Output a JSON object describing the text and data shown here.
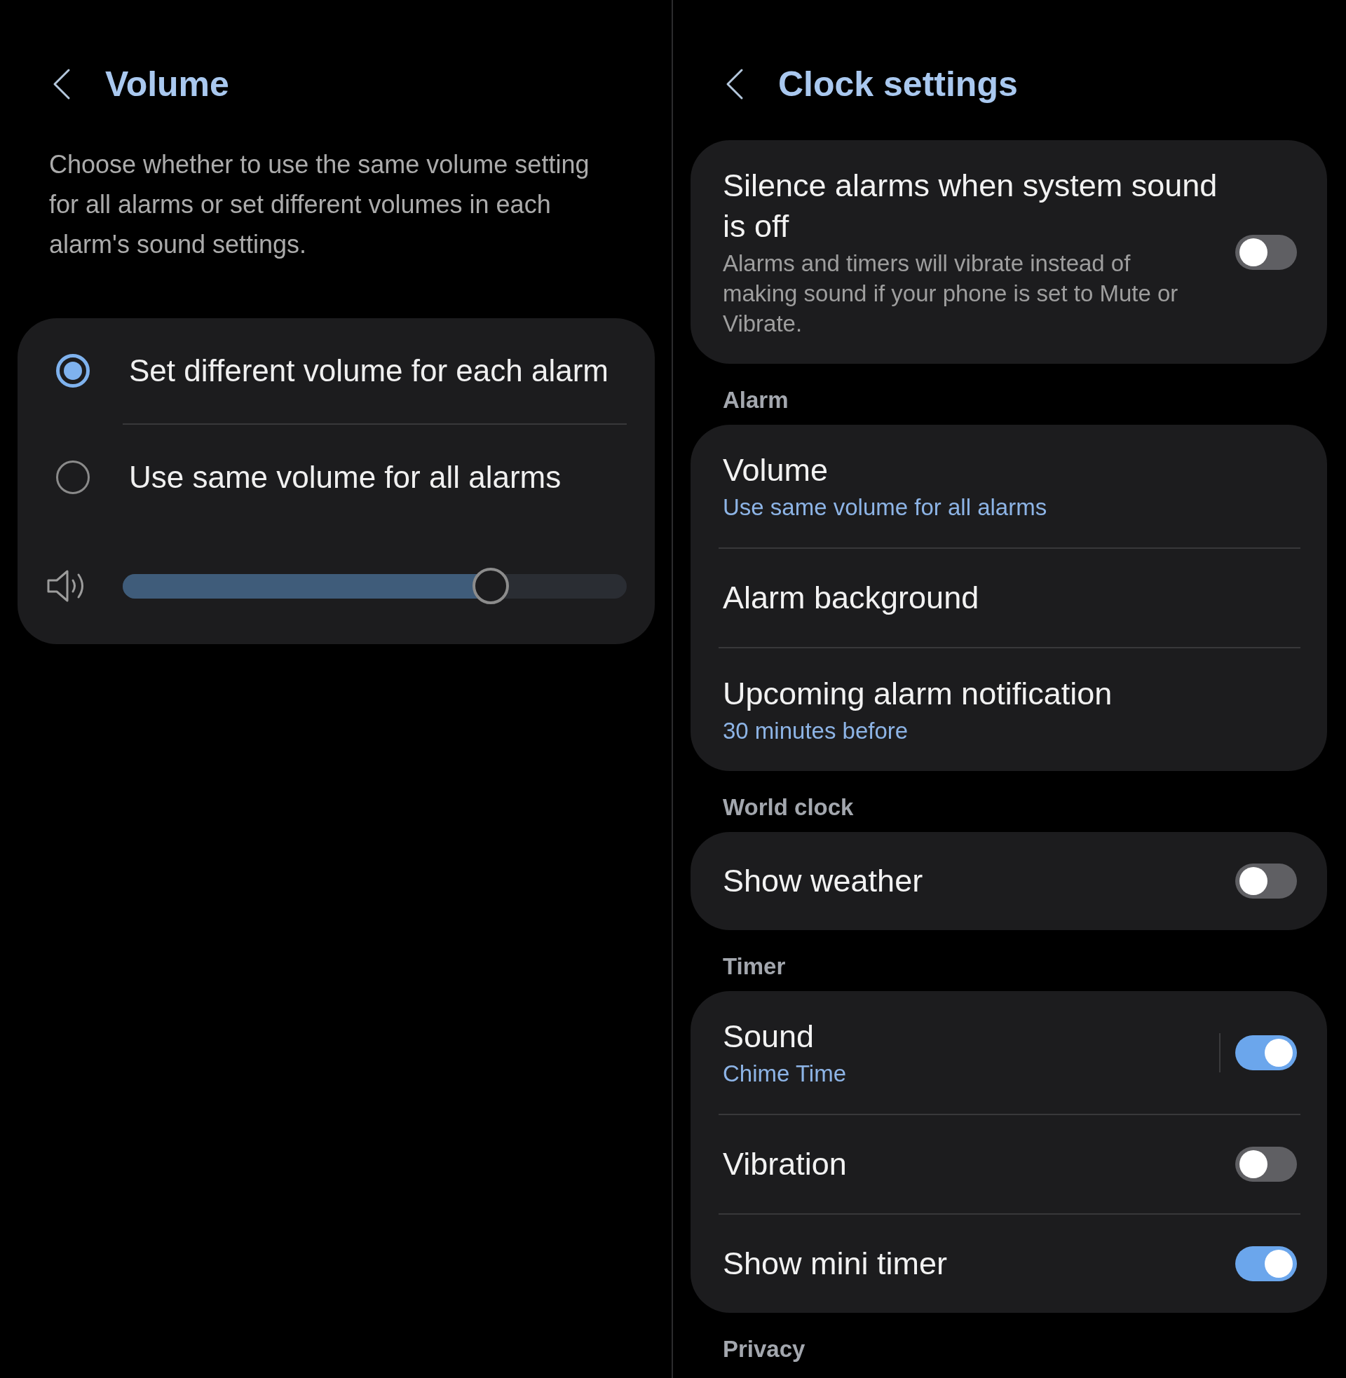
{
  "volume_screen": {
    "title": "Volume",
    "description": "Choose whether to use the same volume setting for all alarms or set different volumes in each alarm's sound settings.",
    "options": [
      {
        "label": "Set different volume for each alarm",
        "selected": true
      },
      {
        "label": "Use same volume for all alarms",
        "selected": false
      }
    ],
    "volume_slider": {
      "level": 0.73
    }
  },
  "clock_settings_screen": {
    "title": "Clock settings",
    "sections": [
      {
        "items": [
          {
            "kind": "switch",
            "title": "Silence alarms when system sound is off",
            "description": "Alarms and timers will vibrate instead of making sound if your phone is set to Mute or Vibrate.",
            "on": false
          }
        ]
      },
      {
        "header": "Alarm",
        "items": [
          {
            "kind": "link",
            "title": "Volume",
            "value": "Use same volume for all alarms"
          },
          {
            "kind": "link",
            "title": "Alarm background"
          },
          {
            "kind": "link",
            "title": "Upcoming alarm notification",
            "value": "30 minutes before"
          }
        ]
      },
      {
        "header": "World clock",
        "items": [
          {
            "kind": "switch",
            "title": "Show weather",
            "on": false
          }
        ]
      },
      {
        "header": "Timer",
        "items": [
          {
            "kind": "split_switch",
            "title": "Sound",
            "value": "Chime Time",
            "on": true
          },
          {
            "kind": "switch",
            "title": "Vibration",
            "on": false
          },
          {
            "kind": "switch",
            "title": "Show mini timer",
            "on": true
          }
        ]
      },
      {
        "header": "Privacy"
      }
    ]
  }
}
